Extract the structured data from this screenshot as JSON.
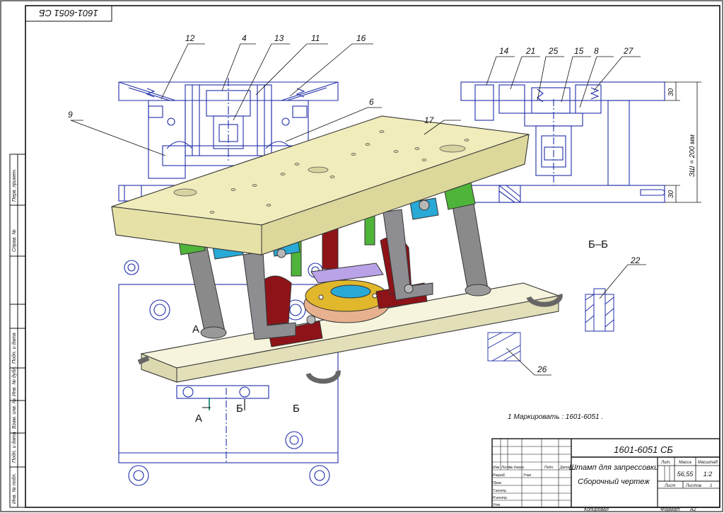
{
  "document": {
    "rotated_code": "1601-6051 СБ",
    "drawing_code": "1601-6051 СБ",
    "title_line1": "Штамп для запрессовки",
    "title_line2": "Сборочный чертеж",
    "mass_value": "56,55",
    "scale_value": "1:2",
    "sheet_value": "1",
    "note": "1 Маркировать : 1601-6051 .",
    "format_label": "Формат",
    "format_value": "А2",
    "copied_label": "Копировал"
  },
  "title_block": {
    "col_headers": [
      "Изм",
      "Лист",
      "№ докум.",
      "Подп.",
      "Дата"
    ],
    "row_labels": [
      "Разраб.",
      "Пров.",
      "Т.контр.",
      "",
      "Н.контр.",
      "Утв."
    ],
    "developer": "Учак",
    "lit_label": "Лит.",
    "mass_label": "Масса",
    "scale_label": "Масштаб",
    "sheet_label": "Лист",
    "sheets_label": "Листов"
  },
  "side_stamps": [
    "Перв. примен.",
    "Справ. №",
    "Подп. и дата",
    "Инв. № дубл.",
    "Взам. инв. №",
    "Подп. и дата",
    "Инв. № подл."
  ],
  "callouts": [
    "12",
    "4",
    "13",
    "11",
    "16",
    "6",
    "9",
    "14",
    "21",
    "25",
    "15",
    "8",
    "27",
    "17",
    "22",
    "26"
  ],
  "section": {
    "title": "Б–Б",
    "marks": [
      "А",
      "А",
      "Б",
      "Б"
    ]
  },
  "dimensions": {
    "height": "ЗШ = 200 мм",
    "top": "30",
    "bottom": "30"
  },
  "colors": {
    "outline": "#1f2fa8",
    "upper_plate": "#ece8b0",
    "lower_plate": "#f3f1d4",
    "column": "#8a8a8a",
    "guide_green": "#4fb43a",
    "pusher_red": "#8e1318",
    "plate_purple": "#b9a3e6",
    "die_yellow": "#e1b72b",
    "cyan_block": "#29a9d6",
    "bracket_gray": "#8d8d92"
  }
}
